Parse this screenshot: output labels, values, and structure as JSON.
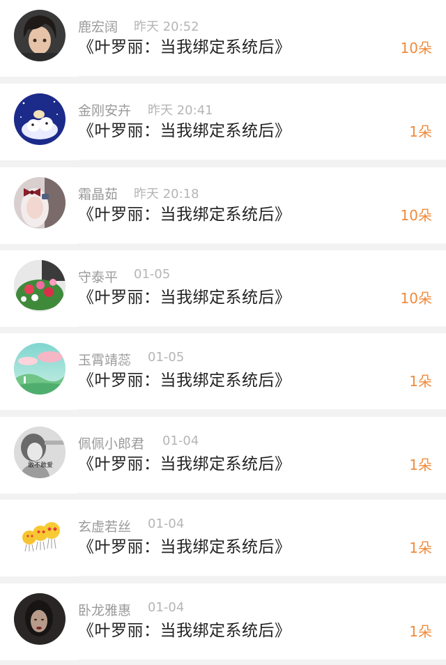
{
  "gifts": [
    {
      "name": "鹿宏阔",
      "time": "昨天 20:52",
      "book": "《叶罗丽：当我绑定系统后》",
      "count": "10朵",
      "avatar": "anime-boy"
    },
    {
      "name": "金刚安卉",
      "time": "昨天 20:41",
      "book": "《叶罗丽：当我绑定系统后》",
      "count": "1朵",
      "avatar": "cartoon-sheep"
    },
    {
      "name": "霜晶茹",
      "time": "昨天 20:18",
      "book": "《叶罗丽：当我绑定系统后》",
      "count": "10朵",
      "avatar": "girl-bow"
    },
    {
      "name": "守泰平",
      "time": "01-05",
      "book": "《叶罗丽：当我绑定系统后》",
      "count": "10朵",
      "avatar": "flowers"
    },
    {
      "name": "玉霄靖蕊",
      "time": "01-05",
      "book": "《叶罗丽：当我绑定系统后》",
      "count": "1朵",
      "avatar": "landscape"
    },
    {
      "name": "佩佩小郎君",
      "time": "01-04",
      "book": "《叶罗丽：当我绑定系统后》",
      "count": "1朵",
      "avatar": "bw-girl",
      "avatar_text": "敢不敢爱"
    },
    {
      "name": "玄虚若丝",
      "time": "01-04",
      "book": "《叶罗丽：当我绑定系统后》",
      "count": "1朵",
      "avatar": "heart-eyes-emoji"
    },
    {
      "name": "卧龙雅惠",
      "time": "01-04",
      "book": "《叶罗丽：当我绑定系统后》",
      "count": "1朵",
      "avatar": "dark-portrait"
    }
  ],
  "colors": {
    "count": "#f08a3a",
    "name": "#9a9a9a",
    "time": "#b5b5b5",
    "title": "#222222"
  }
}
